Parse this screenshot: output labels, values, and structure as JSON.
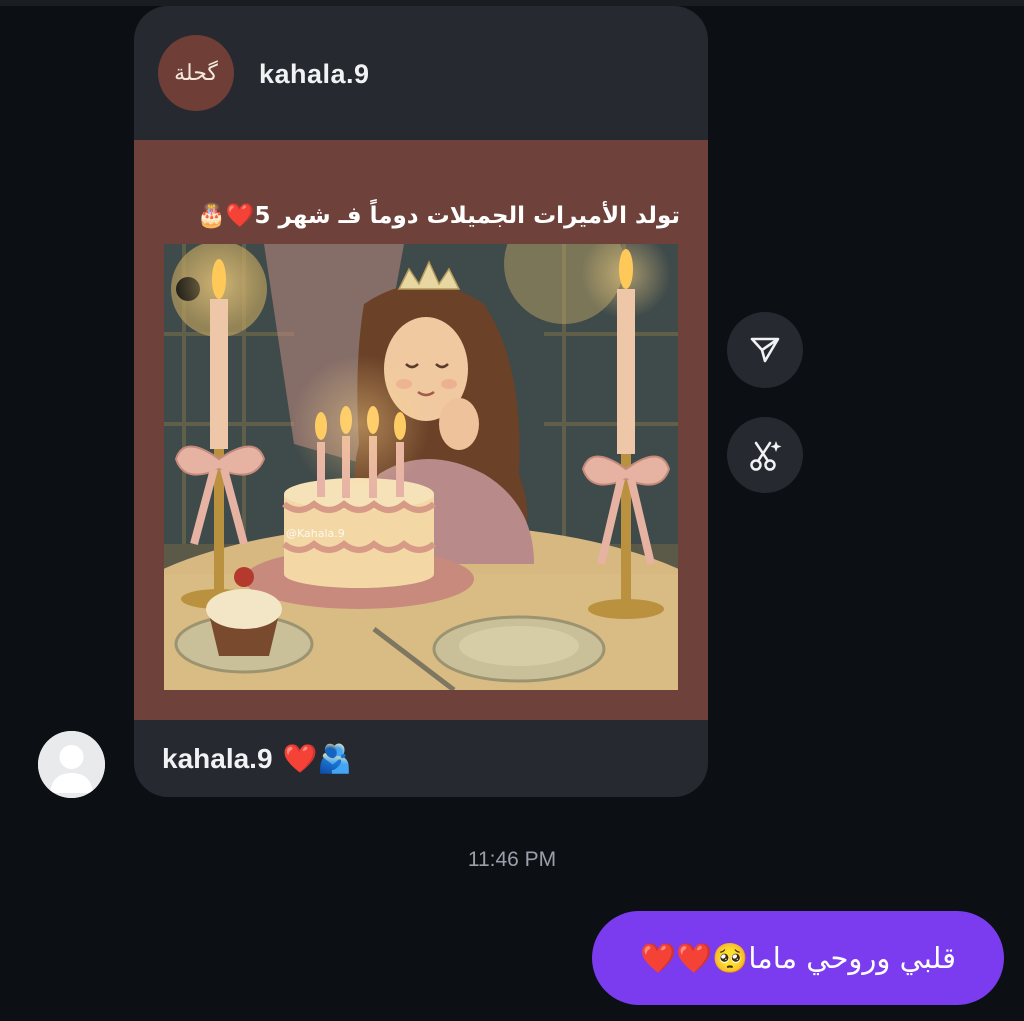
{
  "post": {
    "author_avatar_text": "گحلة",
    "author_username": "kahala.9",
    "image_caption": "تولد الأميرات الجميلات دوماً فـ شهر 5❤️🎂",
    "image_watermark": "@Kahala.9",
    "footer_username": "kahala.9",
    "footer_emojis": "❤️🫂"
  },
  "side_actions": {
    "share_icon": "send-icon",
    "remix_icon": "scissors-sparkle-icon"
  },
  "chat": {
    "timestamp": "11:46 PM",
    "outgoing_message": "قلبي وروحي ماما🥺❤️❤️"
  },
  "colors": {
    "background": "#0c0f14",
    "card": "#262930",
    "image_frame": "#6e423b",
    "outgoing_bubble": "#7b3cf0",
    "timestamp": "#9aa0aa"
  }
}
